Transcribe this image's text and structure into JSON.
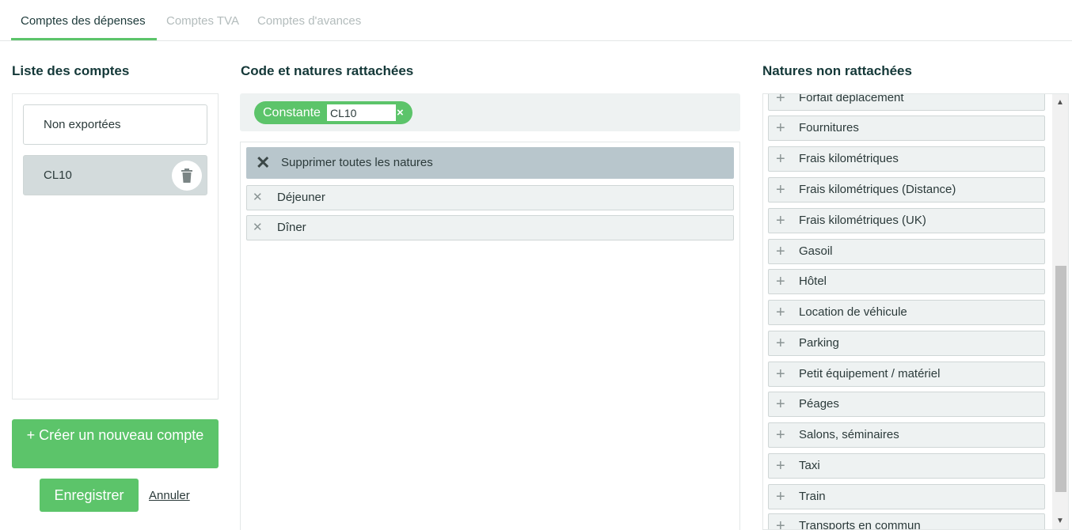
{
  "tabs": [
    {
      "label": "Comptes des dépenses",
      "active": true
    },
    {
      "label": "Comptes TVA",
      "active": false
    },
    {
      "label": "Comptes d'avances",
      "active": false
    }
  ],
  "accounts": {
    "title": "Liste des comptes",
    "items": [
      "Non exportées",
      "CL10"
    ],
    "selected": "CL10",
    "create_label": "+ Créer un nouveau compte",
    "save_label": "Enregistrer",
    "cancel_label": "Annuler"
  },
  "code": {
    "title": "Code et natures rattachées",
    "pill_label": "Constante",
    "value": "CL10",
    "clear_glyph": "×",
    "remove_all_label": "Supprimer toutes les natures",
    "attached": [
      "Déjeuner",
      "Dîner"
    ]
  },
  "unattached": {
    "title": "Natures non rattachées",
    "items": [
      "Forfait déplacement",
      "Fournitures",
      "Frais kilométriques",
      "Frais kilométriques (Distance)",
      "Frais kilométriques (UK)",
      "Gasoil",
      "Hôtel",
      "Location de véhicule",
      "Parking",
      "Petit équipement / matériel",
      "Péages",
      "Salons, séminaires",
      "Taxi",
      "Train",
      "Transports en commun"
    ]
  },
  "colors": {
    "accent": "#5cc46a",
    "selected_bg": "#d3dbdc",
    "remove_all_bg": "#b8c6cc",
    "item_bg": "#eef2f2",
    "title": "#143838"
  },
  "icons": {
    "trash": "trash-icon",
    "remove": "close-icon",
    "add": "plus-icon",
    "scroll_up": "chevron-up-icon",
    "scroll_down": "chevron-down-icon"
  }
}
